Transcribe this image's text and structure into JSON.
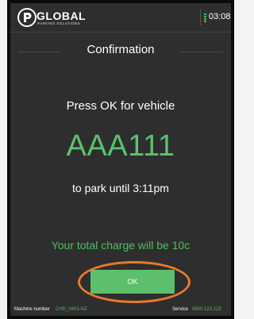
{
  "brand": {
    "name": "GLOBAL",
    "tagline": "PARKING SOLUTIONS"
  },
  "status": {
    "time": "03:08",
    "signal_color": "#3fc152"
  },
  "screen": {
    "title": "Confirmation",
    "prompt": "Press OK for vehicle",
    "plate": "AAA111",
    "until_text": "to park until 3:11pm",
    "charge_text": "Your total charge will be 10c",
    "ok_label": "OK"
  },
  "footer": {
    "machine_label": "Machine number",
    "machine_value": "CHD_0401-NZ",
    "service_label": "Service",
    "service_value": "0800 123 123"
  },
  "colors": {
    "screen_bg": "#2e2e2e",
    "accent_green": "#5cbf6c",
    "highlight_ring": "#e87a2c"
  }
}
